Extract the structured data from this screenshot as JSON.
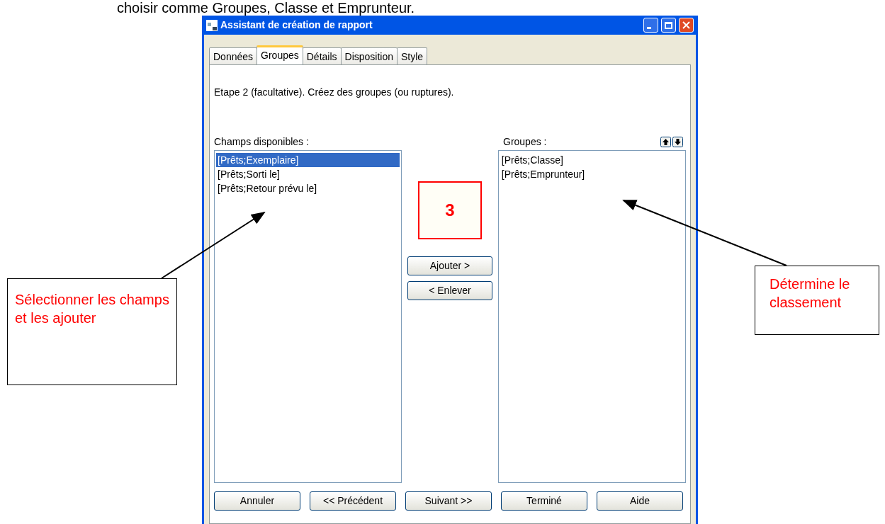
{
  "page_caption": "choisir comme Groupes, Classe et Emprunteur.",
  "window": {
    "title": "Assistant de création de rapport"
  },
  "tabs": [
    {
      "label": "Données",
      "selected": false
    },
    {
      "label": "Groupes",
      "selected": true
    },
    {
      "label": "Détails",
      "selected": false
    },
    {
      "label": "Disposition",
      "selected": false
    },
    {
      "label": "Style",
      "selected": false
    }
  ],
  "step_text": "Etape 2 (facultative). Créez des groupes (ou ruptures).",
  "available_fields": {
    "label": "Champs disponibles :",
    "items": [
      {
        "text": "[Prêts;Exemplaire]",
        "selected": true
      },
      {
        "text": "[Prêts;Sorti le]",
        "selected": false
      },
      {
        "text": "[Prêts;Retour prévu le]",
        "selected": false
      }
    ]
  },
  "groups": {
    "label": "Groupes :",
    "items": [
      {
        "text": "[Prêts;Classe]",
        "selected": false
      },
      {
        "text": "[Prêts;Emprunteur]",
        "selected": false
      }
    ]
  },
  "move_buttons": [
    "Ajouter >",
    "< Enlever"
  ],
  "step_badge": "3",
  "footer_buttons": [
    "Annuler",
    "<< Précédent",
    "Suivant >>",
    "Terminé",
    "Aide"
  ],
  "annotations": [
    {
      "text": "Sélectionner les champs et les ajouter"
    },
    {
      "text": "Détermine le classement"
    }
  ]
}
